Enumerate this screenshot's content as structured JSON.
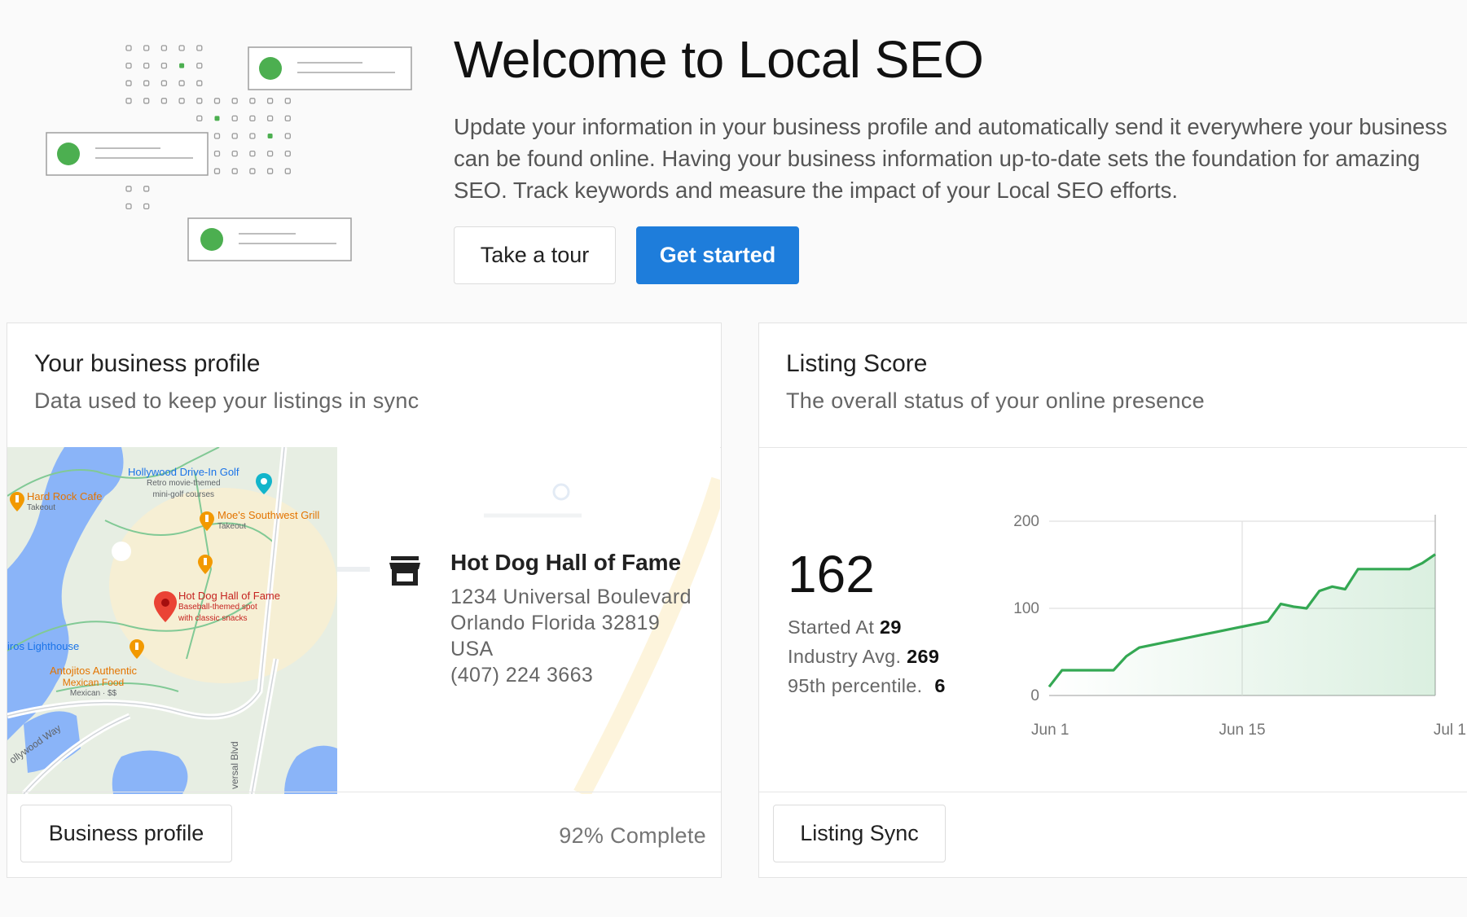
{
  "hero": {
    "title": "Welcome to Local SEO",
    "description": "Update your information in your business profile and automatically send it everywhere your business can be found online. Having your business information up-to-date sets the foundation for amazing SEO. Track keywords and measure the impact of your Local SEO efforts.",
    "tour_label": "Take a tour",
    "start_label": "Get started"
  },
  "profile_card": {
    "title": "Your business profile",
    "subtitle": "Data used to keep your listings in sync",
    "map_labels": {
      "drivein": "Hollywood Drive-In Golf",
      "drivein_sub1": "Retro movie-themed",
      "drivein_sub2": "mini-golf courses",
      "hardrock": "Hard Rock Cafe",
      "hardrock_sub": "Takeout",
      "moes": "Moe's Southwest Grill",
      "moes_sub": "Takeout",
      "hotdog": "Hot Dog Hall of Fame",
      "hotdog_sub1": "Baseball-themed spot",
      "hotdog_sub2": "with classic snacks",
      "lighthouse": "iros Lighthouse",
      "antojitos": "Antojitos Authentic",
      "antojitos_sub1": "Mexican Food",
      "antojitos_sub2": "Mexican · $$",
      "street1": "ollywood Way",
      "street2": "versal Blvd"
    },
    "business": {
      "name": "Hot Dog Hall of Fame",
      "street": "1234 Universal Boulevard",
      "city": "Orlando Florida 32819",
      "country": "USA",
      "phone": "(407) 224 3663"
    },
    "button_label": "Business profile",
    "completion": "92% Complete"
  },
  "score_card": {
    "title": "Listing Score",
    "subtitle": "The overall status of your online presence",
    "score": "162",
    "started_label": "Started At",
    "started_value": "29",
    "industry_label": "Industry Avg.",
    "industry_value": "269",
    "percentile_label": "95th percentile.",
    "percentile_value": "6",
    "button_label": "Listing Sync"
  },
  "chart_data": {
    "type": "line",
    "x_tick_labels": [
      "Jun 1",
      "Jun 15",
      "Jul 1"
    ],
    "y_tick_labels": [
      "0",
      "100",
      "200"
    ],
    "ylim": [
      0,
      200
    ],
    "xlim": [
      0,
      30
    ],
    "grid": true,
    "series": [
      {
        "color": "#34a853",
        "x": [
          0,
          1,
          2,
          3,
          4,
          5,
          6,
          7,
          8,
          9,
          10,
          11,
          12,
          13,
          14,
          15,
          16,
          17,
          18,
          19,
          20,
          21,
          22,
          23,
          24,
          25,
          26,
          27,
          28,
          29,
          30
        ],
        "y": [
          10,
          29,
          29,
          29,
          29,
          29,
          45,
          55,
          58,
          61,
          64,
          67,
          70,
          73,
          76,
          79,
          82,
          85,
          105,
          102,
          100,
          120,
          125,
          122,
          145,
          145,
          145,
          145,
          145,
          152,
          162
        ]
      }
    ]
  },
  "colors": {
    "accent": "#1e7ddb",
    "chart_line": "#34a853",
    "illustration_dot": "#4caf50"
  }
}
